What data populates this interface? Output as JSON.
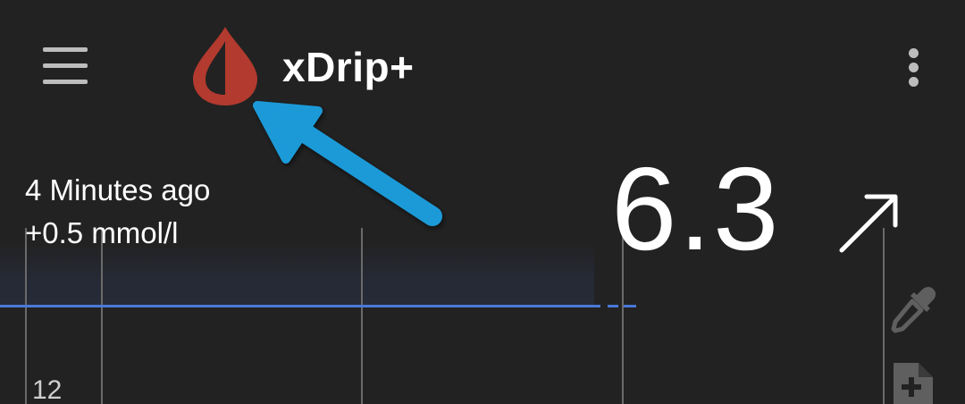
{
  "toolbar": {
    "app_title": "xDrip+"
  },
  "reading": {
    "time_ago": "4 Minutes ago",
    "delta": "+0.5 mmol/l",
    "value": "6.3",
    "trend": "rising"
  },
  "graph": {
    "axis_label": "12"
  },
  "icons": {
    "menu": "hamburger-menu-icon",
    "logo": "blood-drop-logo",
    "overflow": "more-vertical-icon",
    "trend": "arrow-up-right-icon",
    "pipette": "pipette-icon",
    "note": "add-note-icon"
  },
  "colors": {
    "background": "#222222",
    "logo_red": "#b23a2e",
    "target_line": "#4a78d8",
    "annotation_arrow": "#1a9ad8",
    "text": "#ffffff"
  }
}
